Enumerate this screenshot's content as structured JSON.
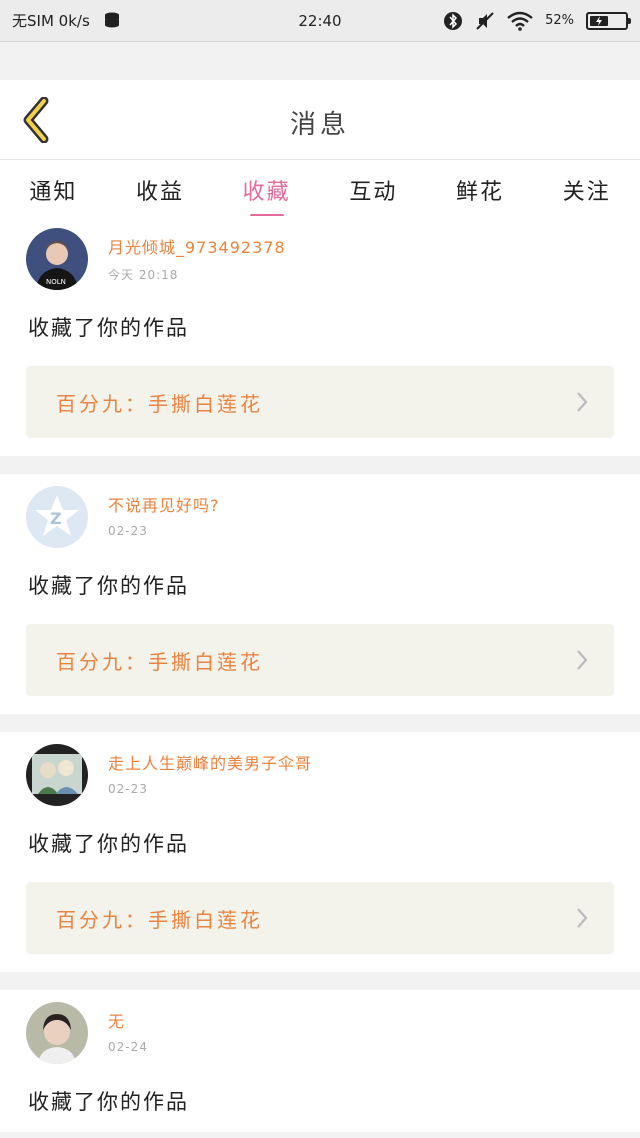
{
  "status_bar": {
    "carrier": "无SIM 0k/s",
    "time": "22:40",
    "battery": "52%",
    "icons": [
      "database-icon",
      "bluetooth-icon",
      "mute-icon",
      "wifi-icon",
      "battery-icon"
    ]
  },
  "header": {
    "title": "消息",
    "back_icon": "chevron-left-icon"
  },
  "tabs": [
    {
      "label": "通知",
      "active": false
    },
    {
      "label": "收益",
      "active": false
    },
    {
      "label": "收藏",
      "active": true
    },
    {
      "label": "互动",
      "active": false
    },
    {
      "label": "鲜花",
      "active": false
    },
    {
      "label": "关注",
      "active": false
    }
  ],
  "accent": "#e36b9c",
  "name_color": "#e8843f",
  "feed": [
    {
      "username": "月光倾城_973492378",
      "time": "今天 20:18",
      "action": "收藏了你的作品",
      "work": "百分九：手撕白莲花",
      "avatar": "avatar-person-dark"
    },
    {
      "username": "不说再见好吗?",
      "time": "02-23",
      "action": "收藏了你的作品",
      "work": "百分九：手撕白莲花",
      "avatar": "avatar-default-z"
    },
    {
      "username": "走上人生巅峰的美男子伞哥",
      "time": "02-23",
      "action": "收藏了你的作品",
      "work": "百分九：手撕白莲花",
      "avatar": "avatar-photo"
    },
    {
      "username": "无",
      "time": "02-24",
      "action": "收藏了你的作品",
      "work": "",
      "avatar": "avatar-person-light"
    }
  ]
}
